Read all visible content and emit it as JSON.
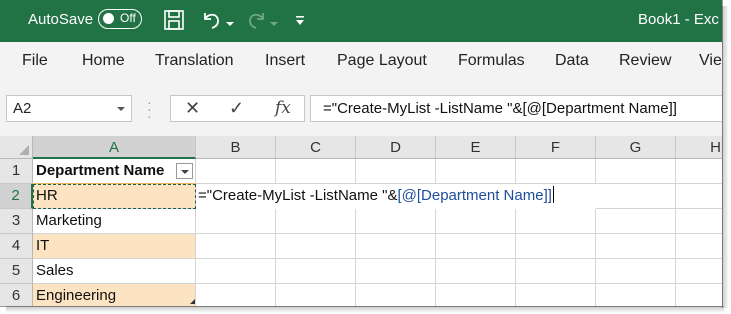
{
  "titlebar": {
    "autosave_label": "AutoSave",
    "autosave_state": "Off",
    "book_title": "Book1  -  Exc",
    "icons": [
      "save-icon",
      "undo-icon",
      "redo-icon",
      "customize-qat-icon"
    ]
  },
  "menu": {
    "items": [
      "File",
      "Home",
      "Translation",
      "Insert",
      "Page Layout",
      "Formulas",
      "Data",
      "Review",
      "Vie"
    ]
  },
  "formula_bar": {
    "name_box": "A2",
    "cancel_glyph": "✕",
    "enter_glyph": "✓",
    "fx_label": "fx",
    "formula": "=\"Create-MyList -ListName \"&[@[Department Name]]"
  },
  "sheet": {
    "columns": [
      "A",
      "B",
      "C",
      "D",
      "E",
      "F",
      "G",
      "H"
    ],
    "rows": [
      "1",
      "2",
      "3",
      "4",
      "5",
      "6"
    ],
    "header_cell": "Department Name",
    "departments": [
      "HR",
      "Marketing",
      "IT",
      "Sales",
      "Engineering"
    ],
    "editing_text_prefix": "=\"Create-MyList -ListName \"&",
    "editing_text_ref": "[@[Department Name]]"
  },
  "colors": {
    "title_green": "#217346",
    "table_band": "#fce4c3",
    "reference_blue": "#1f4e9c"
  }
}
